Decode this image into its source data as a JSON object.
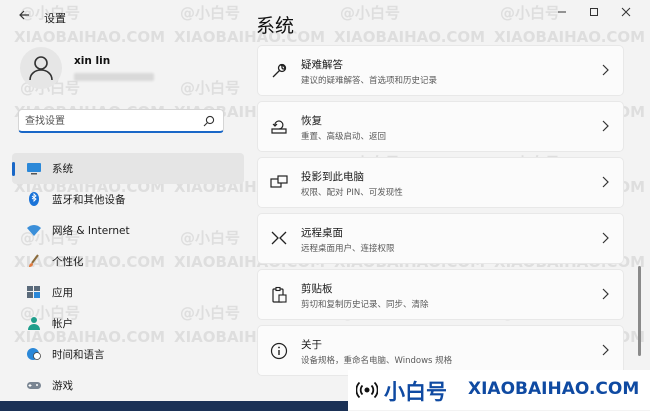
{
  "window": {
    "title": "设置",
    "back_icon": "arrow-left-icon",
    "controls": [
      "minimize",
      "maximize",
      "close"
    ]
  },
  "profile": {
    "name": "xin lin"
  },
  "search": {
    "placeholder": "查找设置"
  },
  "nav": [
    {
      "label": "系统",
      "icon": "system-monitor-icon",
      "active": true
    },
    {
      "label": "蓝牙和其他设备",
      "icon": "bluetooth-icon"
    },
    {
      "label": "网络 & Internet",
      "icon": "network-wifi-icon"
    },
    {
      "label": "个性化",
      "icon": "brush-icon"
    },
    {
      "label": "应用",
      "icon": "apps-icon"
    },
    {
      "label": "帐户",
      "icon": "account-icon"
    },
    {
      "label": "时间和语言",
      "icon": "globe-clock-icon"
    },
    {
      "label": "游戏",
      "icon": "gamepad-icon"
    }
  ],
  "page": {
    "title": "系统"
  },
  "cards": [
    {
      "title": "疑难解答",
      "desc": "建议的疑难解答、首选项和历史记录",
      "icon": "wrench-icon"
    },
    {
      "title": "恢复",
      "desc": "重置、高级启动、返回",
      "icon": "recovery-icon"
    },
    {
      "title": "投影到此电脑",
      "desc": "权限、配对 PIN、可发现性",
      "icon": "project-icon"
    },
    {
      "title": "远程桌面",
      "desc": "远程桌面用户、连接权限",
      "icon": "remote-desktop-icon"
    },
    {
      "title": "剪贴板",
      "desc": "剪切和复制历史记录、同步、清除",
      "icon": "clipboard-icon"
    },
    {
      "title": "关于",
      "desc": "设备规格，重命名电脑、Windows 规格",
      "icon": "info-icon"
    }
  ],
  "watermark": {
    "cn": "@小白号",
    "en": "XIAOBAIHAO.COM",
    "brand_cn": "小白号",
    "brand_en": "XIAOBAIHAO.COM"
  },
  "colors": {
    "accent": "#1967c7",
    "window_bg": "#f3f3f3",
    "card_bg": "#fbfbfb",
    "brand": "#0f4aa2"
  }
}
